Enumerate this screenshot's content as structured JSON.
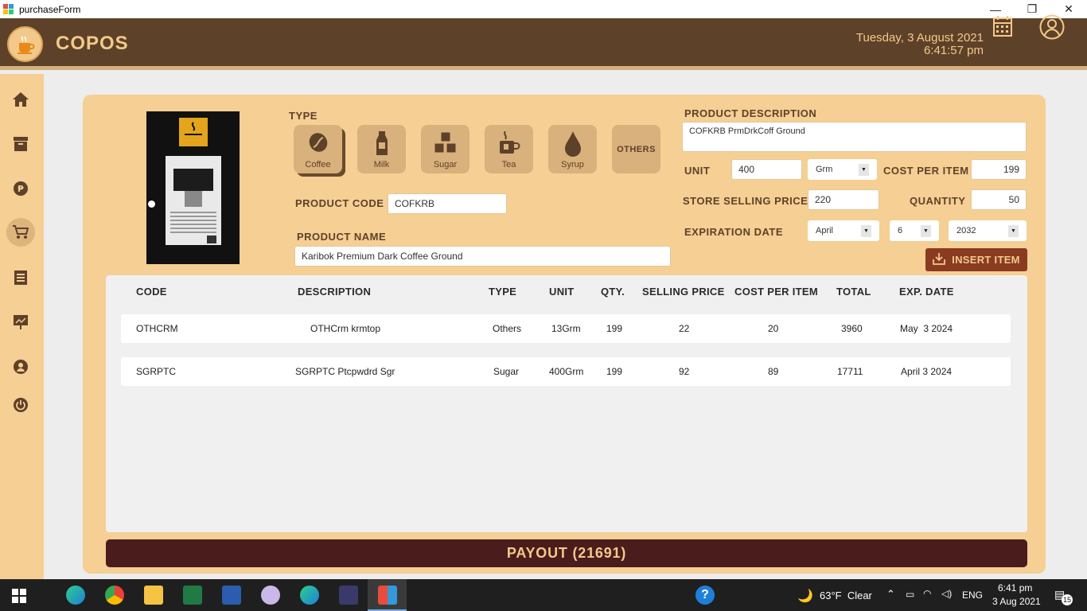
{
  "window": {
    "title": "purchaseForm",
    "minimize": "—",
    "maximize": "❐",
    "close": "✕"
  },
  "header": {
    "brand": "COPOS",
    "date": "Tuesday, 3 August 2021",
    "time": "6:41:57 pm"
  },
  "form": {
    "type_label": "TYPE",
    "types": [
      {
        "label": "Coffee",
        "icon": "coffee-bean-icon",
        "selected": true
      },
      {
        "label": "Milk",
        "icon": "milk-bottle-icon",
        "selected": false
      },
      {
        "label": "Sugar",
        "icon": "sugar-cubes-icon",
        "selected": false
      },
      {
        "label": "Tea",
        "icon": "tea-cup-icon",
        "selected": false
      },
      {
        "label": "Syrup",
        "icon": "syrup-drop-icon",
        "selected": false
      },
      {
        "label": "OTHERS",
        "icon": "",
        "selected": false
      }
    ],
    "product_code_label": "PRODUCT CODE",
    "product_code": "COFKRB",
    "product_name_label": "PRODUCT NAME",
    "product_name": "Karibok Premium Dark Coffee Ground",
    "description_label": "PRODUCT DESCRIPTION",
    "description": "COFKRB PrmDrkCoff Ground",
    "unit_label": "UNIT",
    "unit": "400",
    "unit_type": "Grm",
    "cost_label": "COST PER ITEM",
    "cost": "199",
    "selling_label": "STORE SELLING PRICE",
    "selling": "220",
    "quantity_label": "QUANTITY",
    "quantity": "50",
    "expiration_label": "EXPIRATION DATE",
    "exp_month": "April",
    "exp_day": "6",
    "exp_year": "2032",
    "insert_label": "INSERT ITEM"
  },
  "table": {
    "headers": [
      "CODE",
      "DESCRIPTION",
      "TYPE",
      "UNIT",
      "QTY.",
      "SELLING PRICE",
      "COST PER ITEM",
      "TOTAL",
      "EXP. DATE"
    ],
    "rows": [
      {
        "code": "OTHCRM",
        "description": "OTHCrm krmtop",
        "type": "Others",
        "unit": "13Grm",
        "qty": "199",
        "selling": "22",
        "cost": "20",
        "total": "3960",
        "exp": "May  3 2024"
      },
      {
        "code": "SGRPTC",
        "description": "SGRPTC Ptcpwdrd Sgr",
        "type": "Sugar",
        "unit": "400Grm",
        "qty": "199",
        "selling": "92",
        "cost": "89",
        "total": "17711",
        "exp": "April 3 2024"
      }
    ]
  },
  "payout": "PAYOUT (21691)",
  "taskbar": {
    "weather": "63°F  Clear",
    "lang": "ENG",
    "time": "6:41 pm",
    "date": "3 Aug 2021",
    "notif": "15"
  },
  "colors": {
    "brown": "#5e4129",
    "tan": "#f5cf93",
    "payout": "#4a1c1c",
    "insert": "#8a3b22"
  }
}
